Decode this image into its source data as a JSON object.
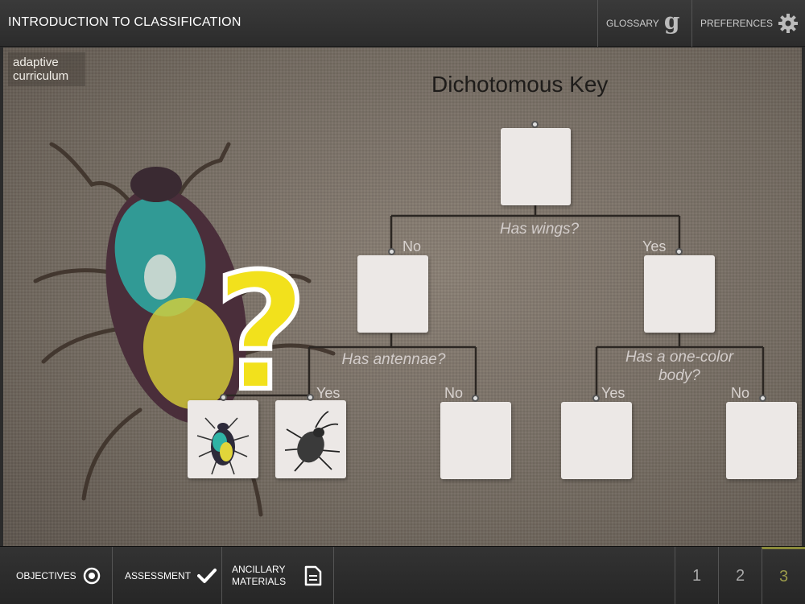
{
  "header": {
    "title": "INTRODUCTION TO CLASSIFICATION",
    "glossary_label": "GLOSSARY",
    "glossary_icon_glyph": "g",
    "preferences_label": "PREFERENCES"
  },
  "brand": {
    "line1": "adaptive",
    "line2": "curriculum"
  },
  "key": {
    "title": "Dichotomous Key",
    "q1": "Has wings?",
    "q2": "Has antennae?",
    "q3_line1": "Has a one-color",
    "q3_line2": "body?",
    "labels": {
      "no1": "No",
      "yes1": "Yes",
      "yes2": "Yes",
      "no2": "No",
      "yes3": "Yes",
      "no3": "No"
    },
    "question_mark": "?"
  },
  "footer": {
    "objectives": "OBJECTIVES",
    "assessment": "ASSESSMENT",
    "ancillary": "ANCILLARY MATERIALS",
    "pages": [
      "1",
      "2",
      "3"
    ],
    "current_page": "3"
  },
  "colors": {
    "accent_page": "#9a9a4a",
    "question_mark": "#f2e11c",
    "brand_accent": "#e6a132"
  }
}
